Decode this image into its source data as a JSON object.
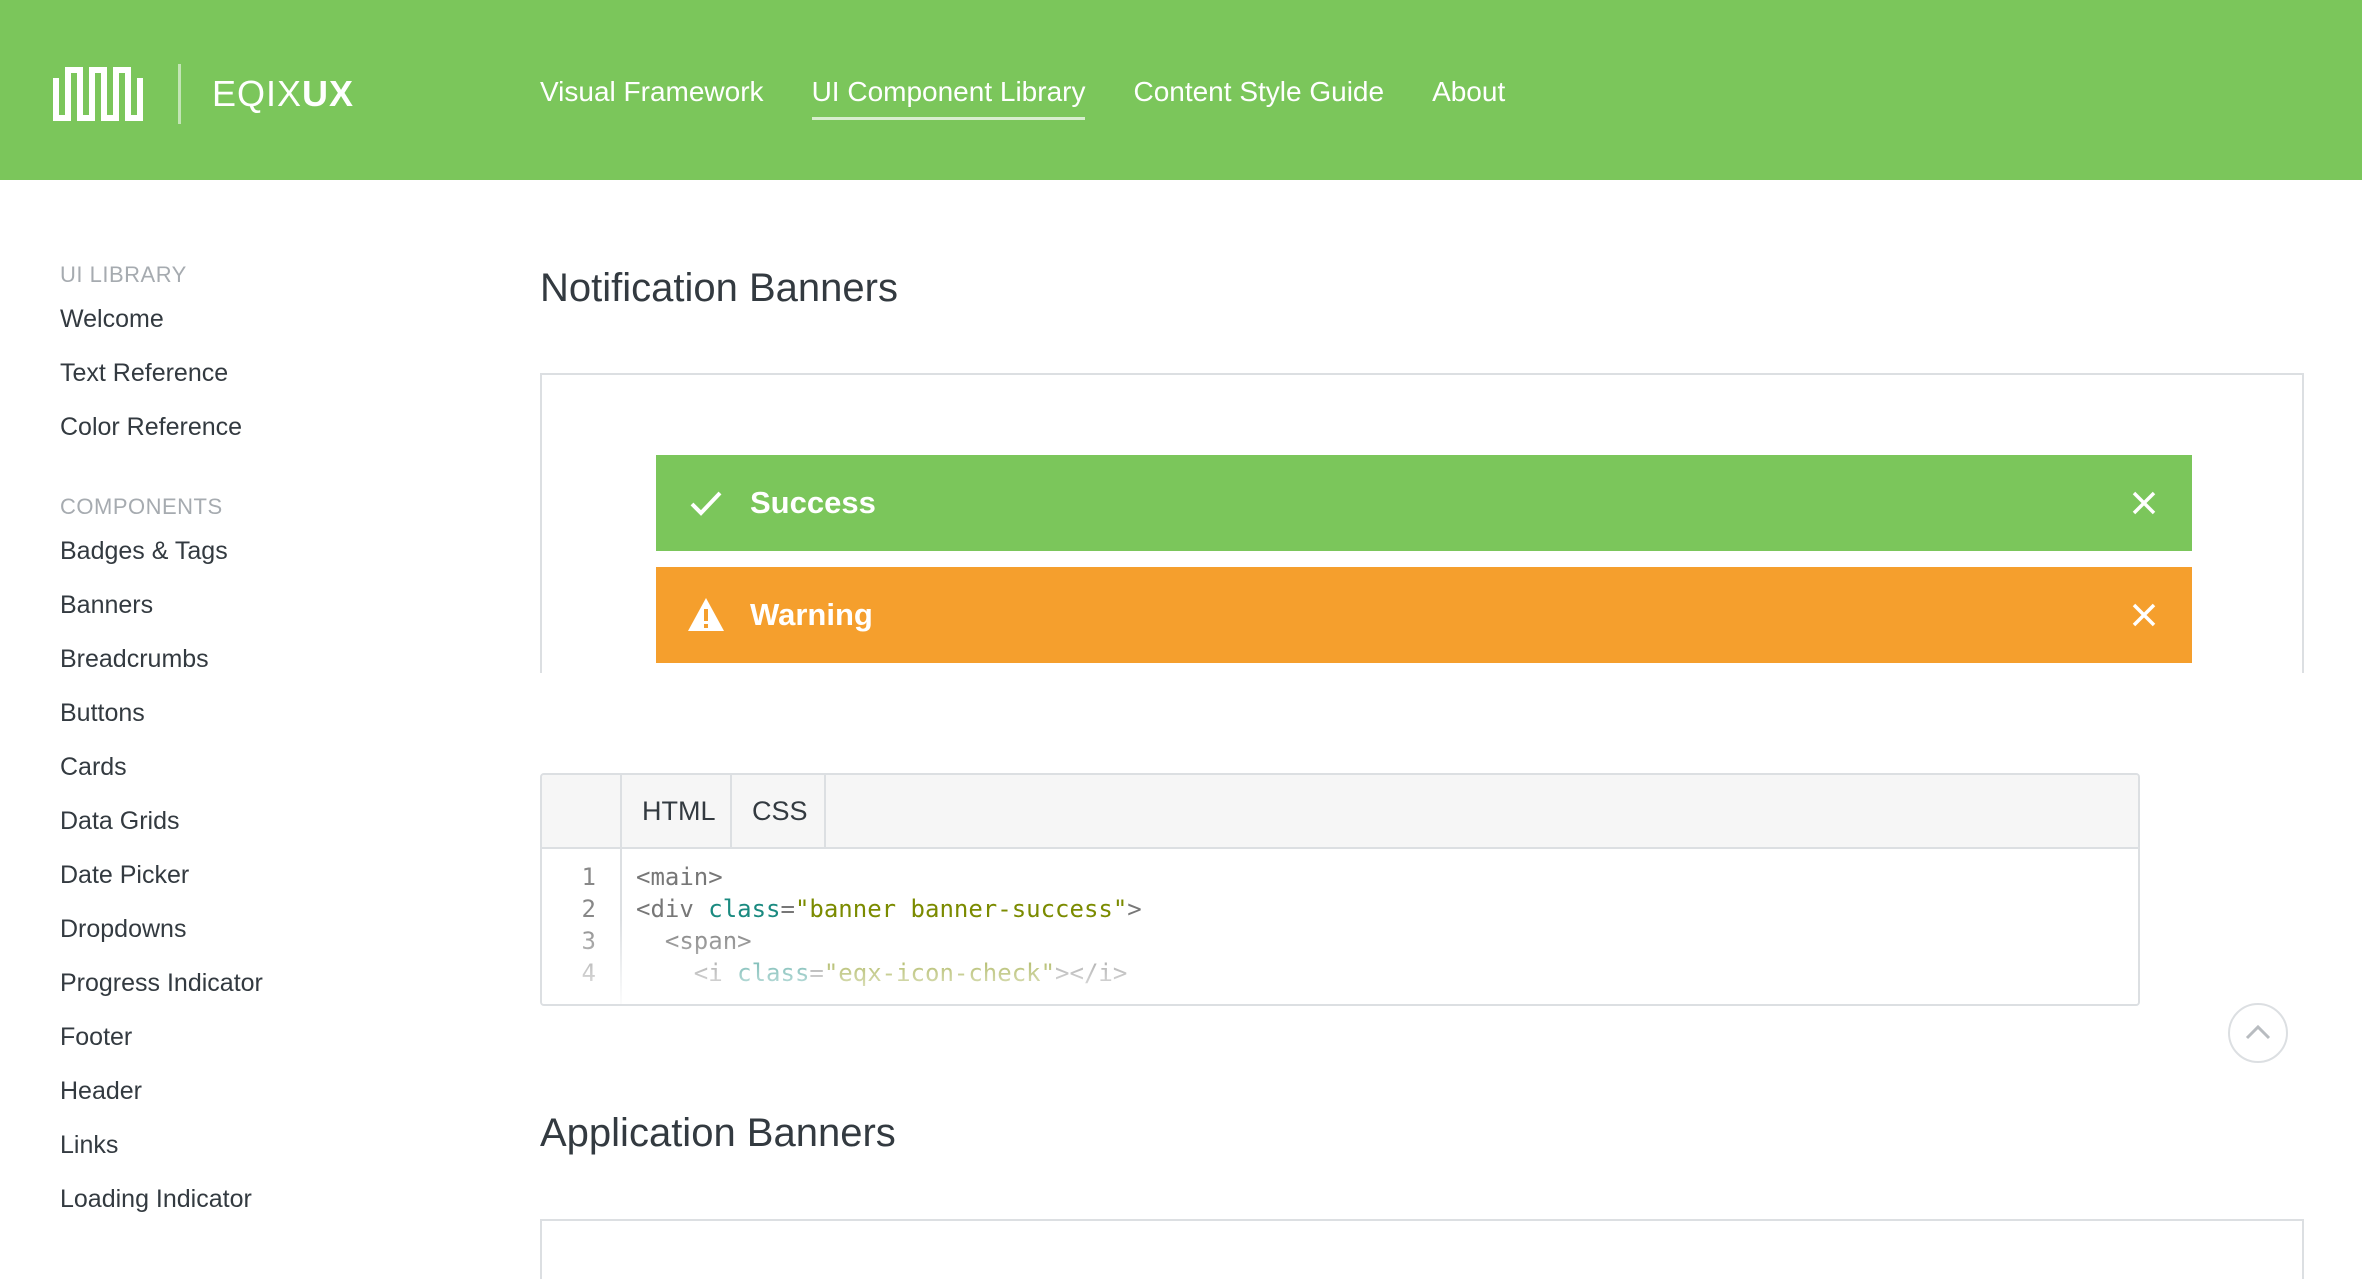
{
  "header": {
    "logo_text_light": "EQIX",
    "logo_text_bold": "UX",
    "nav": [
      {
        "label": "Visual Framework"
      },
      {
        "label": "UI Component Library"
      },
      {
        "label": "Content Style Guide"
      },
      {
        "label": "About"
      }
    ],
    "active_nav": "UI Component Library"
  },
  "sidebar": {
    "sections": [
      {
        "title": "UI LIBRARY",
        "items": [
          "Welcome",
          "Text Reference",
          "Color Reference"
        ]
      },
      {
        "title": "COMPONENTS",
        "items": [
          "Badges & Tags",
          "Banners",
          "Breadcrumbs",
          "Buttons",
          "Cards",
          "Data Grids",
          "Date Picker",
          "Dropdowns",
          "Progress Indicator",
          "Footer",
          "Header",
          "Links",
          "Loading Indicator"
        ]
      }
    ]
  },
  "main": {
    "section1_title": "Notification Banners",
    "banners": [
      {
        "type": "success",
        "label": "Success",
        "icon": "check-icon",
        "color": "#7bc65b"
      },
      {
        "type": "warning",
        "label": "Warning",
        "icon": "warning-triangle-icon",
        "color": "#f59f2d"
      }
    ],
    "code": {
      "tabs": [
        "HTML",
        "CSS"
      ],
      "active_tab": "HTML",
      "lines": [
        {
          "num": "1",
          "pre": "<main>",
          "attr": "",
          "eq": "",
          "str": "",
          "post": ""
        },
        {
          "num": "2",
          "pre": "<div ",
          "attr": "class",
          "eq": "=",
          "str": "\"banner banner-success\"",
          "post": ">"
        },
        {
          "num": "3",
          "pre": "  <span>",
          "attr": "",
          "eq": "",
          "str": "",
          "post": ""
        },
        {
          "num": "4",
          "pre": "    <i ",
          "attr": "class",
          "eq": "=",
          "str": "\"eqx-icon-check\"",
          "post": "></i>"
        }
      ]
    },
    "section2_title": "Application Banners"
  },
  "colors": {
    "brand_green": "#7bc65b",
    "warning_orange": "#f59f2d"
  }
}
